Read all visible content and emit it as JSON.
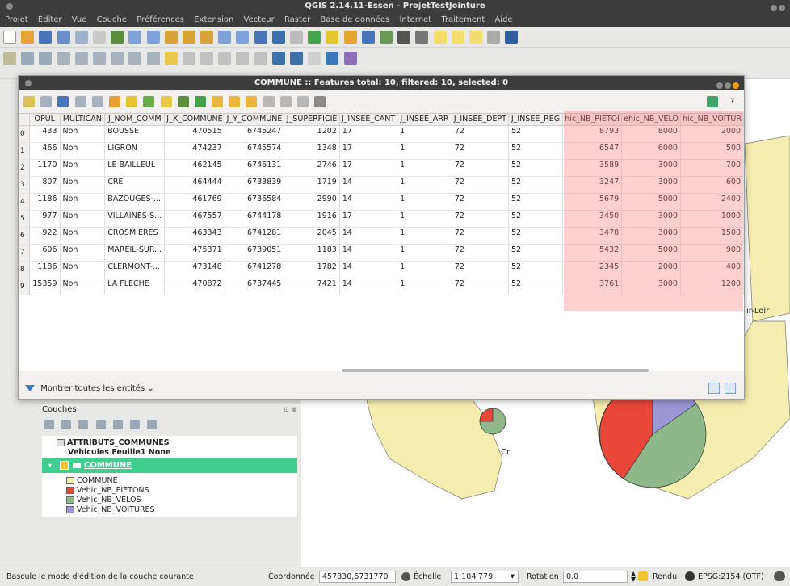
{
  "window": {
    "title": "QGIS 2.14.11-Essen - ProjetTestJointure"
  },
  "menu": [
    "Projet",
    "Éditer",
    "Vue",
    "Couche",
    "Préférences",
    "Extension",
    "Vecteur",
    "Raster",
    "Base de données",
    "Internet",
    "Traitement",
    "Aide"
  ],
  "dialog": {
    "title": "COMMUNE :: Features total: 10, filtered: 10, selected: 0",
    "help": "?",
    "show_all": "Montrer toutes les entités",
    "show_all_arrow": "⌄"
  },
  "table": {
    "columns": [
      "OPUL",
      "MULTICAN",
      "J_NOM_COMM",
      "J_X_COMMUNE",
      "J_Y_COMMUNE",
      "J_SUPERFICIE",
      "J_INSEE_CANT",
      "J_INSEE_ARR",
      "J_INSEE_DEPT",
      "J_INSEE_REG",
      "hic_NB_PIETOI",
      "ehic_NB_VELO",
      "hic_NB_VOITUR"
    ],
    "rows": [
      {
        "n": "0",
        "c": [
          "433",
          "Non",
          "BOUSSE",
          "470515",
          "6745247",
          "1202",
          "17",
          "1",
          "72",
          "52",
          "8793",
          "8000",
          "2000"
        ]
      },
      {
        "n": "1",
        "c": [
          "466",
          "Non",
          "LIGRON",
          "474237",
          "6745574",
          "1348",
          "17",
          "1",
          "72",
          "52",
          "6547",
          "6000",
          "500"
        ]
      },
      {
        "n": "2",
        "c": [
          "1170",
          "Non",
          "LE BAILLEUL",
          "462145",
          "6746131",
          "2746",
          "17",
          "1",
          "72",
          "52",
          "3589",
          "3000",
          "700"
        ]
      },
      {
        "n": "3",
        "c": [
          "807",
          "Non",
          "CRE",
          "464444",
          "6733839",
          "1719",
          "14",
          "1",
          "72",
          "52",
          "3247",
          "3000",
          "600"
        ]
      },
      {
        "n": "4",
        "c": [
          "1186",
          "Non",
          "BAZOUGES-...",
          "461769",
          "6736584",
          "2990",
          "14",
          "1",
          "72",
          "52",
          "5679",
          "5000",
          "2400"
        ]
      },
      {
        "n": "5",
        "c": [
          "977",
          "Non",
          "VILLAINES-S...",
          "467557",
          "6744178",
          "1916",
          "17",
          "1",
          "72",
          "52",
          "3450",
          "3000",
          "1000"
        ]
      },
      {
        "n": "6",
        "c": [
          "922",
          "Non",
          "CROSMIERES",
          "463343",
          "6741281",
          "2045",
          "14",
          "1",
          "72",
          "52",
          "3478",
          "3000",
          "1500"
        ]
      },
      {
        "n": "7",
        "c": [
          "606",
          "Non",
          "MAREIL-SUR...",
          "475371",
          "6739051",
          "1183",
          "14",
          "1",
          "72",
          "52",
          "5432",
          "5000",
          "900"
        ]
      },
      {
        "n": "8",
        "c": [
          "1186",
          "Non",
          "CLERMONT-...",
          "473148",
          "6741278",
          "1782",
          "14",
          "1",
          "72",
          "52",
          "2345",
          "2000",
          "400"
        ]
      },
      {
        "n": "9",
        "c": [
          "15359",
          "Non",
          "LA FLECHE",
          "470872",
          "6737445",
          "7421",
          "14",
          "1",
          "72",
          "52",
          "3761",
          "3000",
          "1200"
        ]
      }
    ]
  },
  "layers": {
    "header": "Couches",
    "header_icons": "⊡ ⊠",
    "group": "ATTRIBUTS_COMMUNES",
    "group_sub": "Vehicules Feuille1 None",
    "active_layer": "COMMUNE",
    "legend": [
      {
        "label": "COMMUNE",
        "color": "#f6edb0"
      },
      {
        "label": "Vehic_NB_PIETONS",
        "color": "#e8473a"
      },
      {
        "label": "Vehic_NB_VELOS",
        "color": "#8fb88a"
      },
      {
        "label": "Vehic_NB_VOITURES",
        "color": "#9b97d4"
      }
    ]
  },
  "map": {
    "label_cr": "Cr",
    "label_loir": "ır-Loir"
  },
  "status": {
    "message": "Bascule le mode d'édition de la couche courante",
    "coord_label": "Coordonnée",
    "coord_value": "457830,6731770",
    "scale_label": "Échelle",
    "scale_value": "1:104'779",
    "rotation_label": "Rotation",
    "rotation_value": "0.0",
    "render_label": "Rendu",
    "crs": "EPSG:2154 (OTF)"
  },
  "colors": {
    "accent": "#3fce8e",
    "highlight": "#ff7878",
    "dark": "#3c3c3c"
  }
}
